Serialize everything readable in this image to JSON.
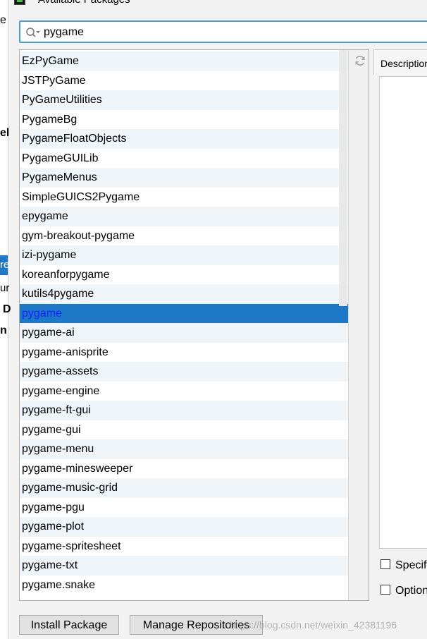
{
  "background_fragments": {
    "e_top": "e",
    "el": "el",
    "blue_tab": "re",
    "ur": "ur",
    "d": "D",
    "n": "n"
  },
  "dialog": {
    "title": "Available Packages",
    "icon": "pycharm-icon"
  },
  "search": {
    "value": "pygame",
    "icon": "search-icon"
  },
  "packages": {
    "items": [
      "EzPyGame",
      "JSTPyGame",
      "PyGameUtilities",
      "PygameBg",
      "PygameFloatObjects",
      "PygameGUILib",
      "PygameMenus",
      "SimpleGUICS2Pygame",
      "epygame",
      "gym-breakout-pygame",
      "izi-pygame",
      "koreanforpygame",
      "kutils4pygame",
      "pygame",
      "pygame-ai",
      "pygame-anisprite",
      "pygame-assets",
      "pygame-engine",
      "pygame-ft-gui",
      "pygame-gui",
      "pygame-menu",
      "pygame-minesweeper",
      "pygame-music-grid",
      "pygame-pgu",
      "pygame-plot",
      "pygame-spritesheet",
      "pygame-txt",
      "pygame.snake"
    ],
    "selected": "pygame",
    "selected_color": "#1d78c8",
    "refresh_icon": "refresh-icon"
  },
  "description": {
    "header": "Description",
    "specify_label": "Specif",
    "options_label": "Option"
  },
  "buttons": {
    "install": "Install Package",
    "manage_repositories": "Manage Repositories"
  },
  "watermark": "https://blog.csdn.net/weixin_42381196"
}
